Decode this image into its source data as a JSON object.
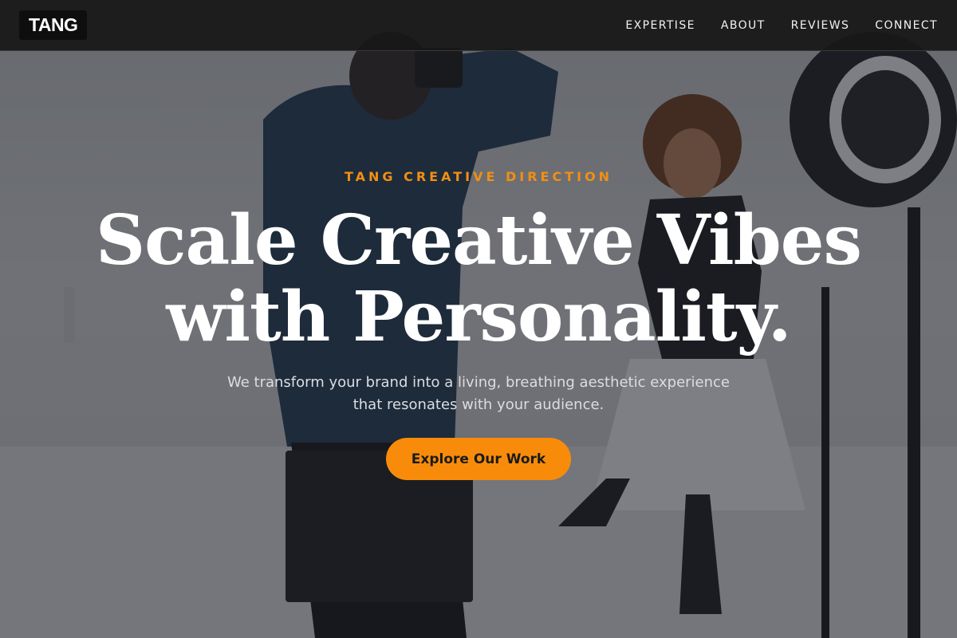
{
  "nav": {
    "logo": "TANG",
    "links": [
      "EXPERTISE",
      "ABOUT",
      "REVIEWS",
      "CONNECT"
    ]
  },
  "hero": {
    "eyebrow": "TANG CREATIVE DIRECTION",
    "headline_line1": "Scale Creative Vibes",
    "headline_line2": "with Personality.",
    "subtitle_line1": "We transform your brand into a living, breathing aesthetic experience",
    "subtitle_line2": "that resonates with your audience.",
    "cta_label": "Explore Our Work"
  },
  "colors": {
    "accent": "#f88c0a",
    "eyebrow": "#f18f13",
    "nav_background": "#181818"
  },
  "background_image": {
    "subject": "photo-studio-shoot",
    "overlay": "dark-tint"
  }
}
